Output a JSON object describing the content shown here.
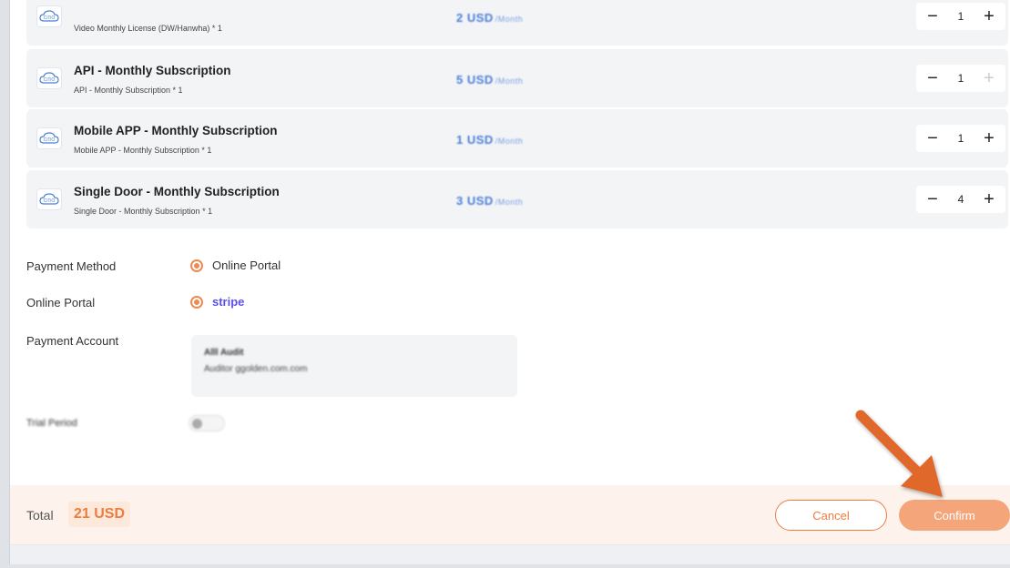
{
  "items": [
    {
      "title": "",
      "subtitle": "Video Monthly License (DW/Hanwha) * 1",
      "price": "2 USD",
      "period": "/Month",
      "qty": "1",
      "plus_disabled": false
    },
    {
      "title": "API - Monthly Subscription",
      "subtitle": "API - Monthly Subscription * 1",
      "price": "5 USD",
      "period": "/Month",
      "qty": "1",
      "plus_disabled": true
    },
    {
      "title": "Mobile APP - Monthly Subscription",
      "subtitle": "Mobile APP - Monthly Subscription * 1",
      "price": "1 USD",
      "period": "/Month",
      "qty": "1",
      "plus_disabled": false
    },
    {
      "title": "Single Door - Monthly Subscription",
      "subtitle": "Single Door - Monthly Subscription * 1",
      "price": "3 USD",
      "period": "/Month",
      "qty": "4",
      "plus_disabled": false
    }
  ],
  "stepper": {
    "minus": "−",
    "plus": "+"
  },
  "logo_text": "CiTiO",
  "payment_method": {
    "label": "Payment Method",
    "value": "Online Portal"
  },
  "online_portal": {
    "label": "Online Portal",
    "value": "stripe"
  },
  "payment_account": {
    "label": "Payment Account",
    "line1": "Alll Audit",
    "line2": "Auditor ggolden.com.com"
  },
  "trial_period": {
    "label": "Trial Period"
  },
  "footer": {
    "total_label": "Total",
    "total_value": "21 USD",
    "cancel": "Cancel",
    "confirm": "Confirm"
  },
  "colors": {
    "accent": "#ec7d3f",
    "stripe": "#5b4ff0",
    "price": "#4a7fd8",
    "arrow": "#e0672b"
  }
}
